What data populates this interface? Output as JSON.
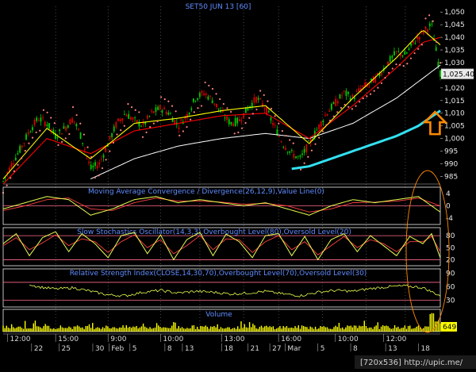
{
  "chart_data": [
    {
      "type": "line",
      "name": "price",
      "title": "SET50 JUN 13",
      "interval": "[60]",
      "y_ticks": [
        "1,050",
        "1,045",
        "1,040",
        "1,035",
        "1,030",
        "1,025",
        "1,020",
        "1,015",
        "1,010",
        "1,005",
        "1,000",
        "995",
        "990",
        "985"
      ],
      "ylim": [
        982,
        1051
      ],
      "last_value": "1,025.40",
      "x_time_labels": [
        "12:00",
        "15:00",
        "9:00",
        "10:00",
        "13:00",
        "16:00",
        "10:00",
        "12:00"
      ],
      "x_date_labels": [
        "22",
        "25",
        "30",
        "Feb",
        "5",
        "8",
        "13",
        "18",
        "21",
        "27",
        "Mar",
        "5",
        "8",
        "13",
        "18"
      ],
      "grid": true,
      "colors": {
        "price_up": "#00cc00",
        "price_down": "#dd0000",
        "fast_ma": "#ffff00",
        "slow_ma": "#ff0000",
        "long_ma": "#ffffff",
        "sar": "#ff8080",
        "highlight": "#33e0f0",
        "arrow": "#ff8800"
      },
      "series": [
        {
          "role": "close",
          "x": [
            0,
            2,
            4,
            6,
            8,
            10,
            12,
            14,
            16,
            18,
            20,
            22,
            24,
            26,
            28,
            30,
            32,
            34,
            36,
            38,
            40,
            42,
            44,
            46,
            48,
            50,
            52,
            54,
            56,
            58,
            60,
            62,
            64,
            66,
            68,
            70,
            72,
            74,
            76,
            78,
            80,
            82,
            84,
            86,
            88,
            90,
            92,
            94,
            96,
            98,
            100
          ],
          "values": [
            983,
            990,
            996,
            1003,
            1008,
            1006,
            1001,
            1004,
            1008,
            1000,
            988,
            990,
            998,
            1006,
            1010,
            1007,
            1005,
            1010,
            1012,
            1010,
            1005,
            1009,
            1016,
            1018,
            1015,
            1010,
            1006,
            1007,
            1012,
            1016,
            1012,
            1005,
            998,
            994,
            992,
            998,
            1004,
            1010,
            1014,
            1018,
            1016,
            1020,
            1022,
            1025,
            1030,
            1034,
            1033,
            1038,
            1042,
            1045,
            1025.4
          ]
        },
        {
          "role": "fast_ma",
          "x": [
            0,
            10,
            20,
            30,
            40,
            50,
            60,
            70,
            80,
            90,
            96,
            100
          ],
          "values": [
            984,
            1004,
            992,
            1006,
            1008,
            1011,
            1013,
            998,
            1016,
            1032,
            1043,
            1037
          ]
        },
        {
          "role": "slow_ma",
          "x": [
            0,
            10,
            20,
            30,
            40,
            50,
            60,
            70,
            80,
            90,
            96,
            100
          ],
          "values": [
            982,
            1000,
            994,
            1003,
            1006,
            1009,
            1010,
            1000,
            1013,
            1028,
            1038,
            1040
          ]
        },
        {
          "role": "long_ma",
          "x": [
            20,
            30,
            40,
            50,
            60,
            70,
            80,
            90,
            100
          ],
          "values": [
            984,
            992,
            997,
            1000,
            1002,
            1000,
            1006,
            1016,
            1029
          ]
        },
        {
          "role": "highlight",
          "x": [
            66,
            70,
            75,
            80,
            85,
            90,
            95,
            100
          ],
          "values": [
            988,
            989,
            992,
            995,
            998,
            1001,
            1005,
            1011
          ]
        }
      ]
    },
    {
      "type": "line",
      "name": "macd",
      "title": "Moving Average Convergence / Divergence(26,12,9),Value Line(0)",
      "y_ticks": [
        "4",
        "0",
        "-4"
      ],
      "ylim": [
        -6,
        6
      ],
      "series": [
        {
          "role": "macd",
          "x": [
            0,
            5,
            10,
            15,
            20,
            25,
            30,
            35,
            40,
            45,
            50,
            55,
            60,
            65,
            70,
            75,
            80,
            85,
            90,
            95,
            100
          ],
          "values": [
            -1,
            1,
            3,
            2,
            -3,
            -1,
            2,
            3,
            1,
            2,
            1,
            0,
            1,
            -1,
            -3,
            0,
            2,
            1,
            2,
            3,
            -2
          ]
        },
        {
          "role": "signal",
          "x": [
            0,
            5,
            10,
            15,
            20,
            25,
            30,
            35,
            40,
            45,
            50,
            55,
            60,
            65,
            70,
            75,
            80,
            85,
            90,
            95,
            100
          ],
          "values": [
            -1.5,
            0,
            2,
            2.5,
            -1,
            -1.5,
            1,
            2.5,
            1.5,
            1.5,
            1.2,
            0.5,
            0.8,
            0,
            -2,
            -1,
            1,
            1.2,
            1.5,
            2.5,
            0
          ]
        }
      ]
    },
    {
      "type": "line",
      "name": "stochastic",
      "title": "Slow Stochastics Oscillator(14,3,3),Overbought Level(80),Oversold Level(20)",
      "y_ticks": [
        "80",
        "50",
        "20"
      ],
      "ylim": [
        5,
        100
      ],
      "series": [
        {
          "role": "k",
          "x": [
            0,
            3,
            6,
            9,
            12,
            15,
            18,
            21,
            24,
            27,
            30,
            33,
            36,
            39,
            42,
            45,
            48,
            51,
            54,
            57,
            60,
            63,
            66,
            69,
            72,
            75,
            78,
            81,
            84,
            87,
            90,
            93,
            96,
            98,
            100
          ],
          "values": [
            60,
            85,
            30,
            75,
            90,
            40,
            85,
            60,
            25,
            80,
            88,
            35,
            82,
            20,
            70,
            88,
            30,
            84,
            65,
            25,
            80,
            85,
            30,
            78,
            20,
            70,
            85,
            40,
            80,
            55,
            30,
            78,
            60,
            85,
            25
          ]
        },
        {
          "role": "d",
          "x": [
            0,
            3,
            6,
            9,
            12,
            15,
            18,
            21,
            24,
            27,
            30,
            33,
            36,
            39,
            42,
            45,
            48,
            51,
            54,
            57,
            60,
            63,
            66,
            69,
            72,
            75,
            78,
            81,
            84,
            87,
            90,
            93,
            96,
            98,
            100
          ],
          "values": [
            55,
            75,
            45,
            62,
            82,
            55,
            72,
            65,
            38,
            65,
            82,
            50,
            70,
            35,
            55,
            80,
            45,
            72,
            70,
            38,
            65,
            80,
            45,
            65,
            32,
            55,
            78,
            50,
            70,
            60,
            40,
            65,
            65,
            78,
            40
          ]
        }
      ]
    },
    {
      "type": "line",
      "name": "rsi",
      "title": "Relative Strength Index(CLOSE,14,30,70),Overbought Level(70),Oversold Level(30)",
      "y_ticks": [
        "90",
        "60",
        "30"
      ],
      "ylim": [
        15,
        100
      ],
      "series": [
        {
          "role": "rsi",
          "x": [
            0,
            4,
            8,
            12,
            16,
            20,
            24,
            28,
            32,
            36,
            40,
            44,
            48,
            52,
            56,
            60,
            64,
            68,
            72,
            76,
            80,
            84,
            88,
            92,
            96,
            100
          ],
          "values": [
            80,
            72,
            60,
            55,
            58,
            50,
            42,
            40,
            48,
            52,
            46,
            50,
            48,
            44,
            46,
            50,
            44,
            40,
            48,
            52,
            50,
            56,
            60,
            62,
            58,
            40
          ]
        }
      ]
    },
    {
      "type": "bar",
      "name": "volume",
      "title": "Volume",
      "last_value": "649",
      "colors": {
        "bar": "#ffff00"
      }
    }
  ],
  "credit": "[720x536] http://upic.me/"
}
